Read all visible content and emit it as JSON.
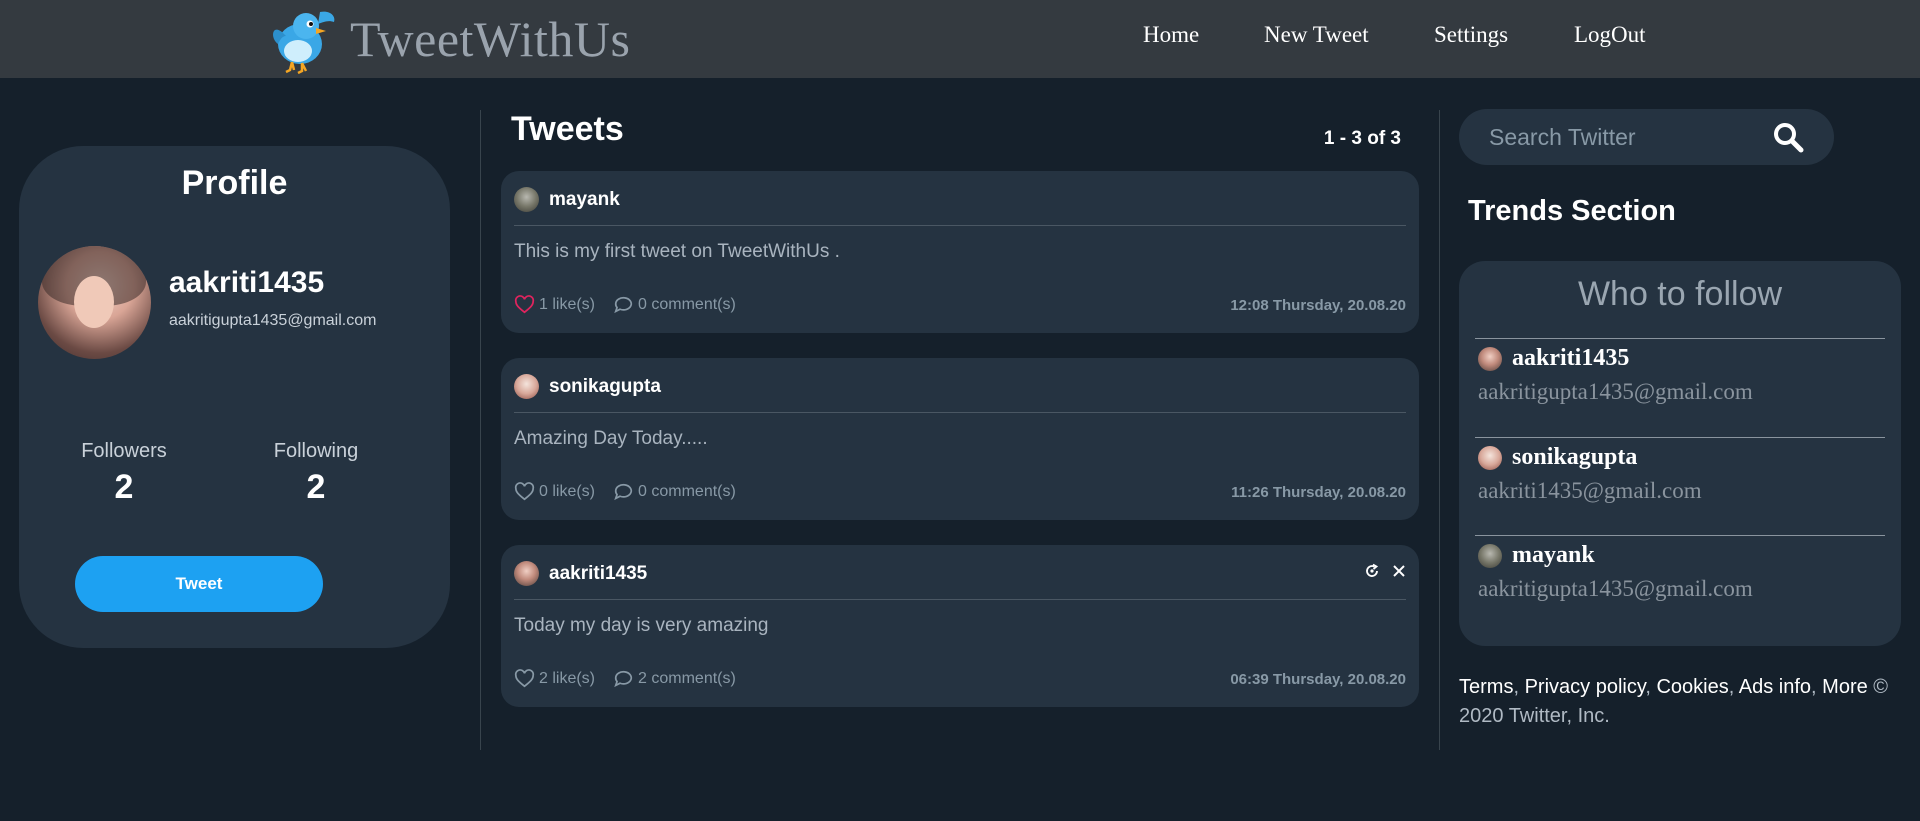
{
  "nav": {
    "brand": "TweetWithUs",
    "links": [
      "Home",
      "New Tweet",
      "Settings",
      "LogOut"
    ]
  },
  "profile": {
    "title": "Profile",
    "username": "aakriti1435",
    "email": "aakritigupta1435@gmail.com",
    "followers_label": "Followers",
    "followers_count": "2",
    "following_label": "Following",
    "following_count": "2",
    "tweet_button": "Tweet"
  },
  "feed": {
    "title": "Tweets",
    "pagination": "1 - 3 of 3",
    "tweets": [
      {
        "user": "mayank",
        "text": "This is my first tweet on TweetWithUs .",
        "likes": "1 like(s)",
        "comments": "0 comment(s)",
        "time": "12:08 Thursday, 20.08.20",
        "liked": true
      },
      {
        "user": "sonikagupta",
        "text": "Amazing Day Today.....",
        "likes": "0 like(s)",
        "comments": "0 comment(s)",
        "time": "11:26 Thursday, 20.08.20",
        "liked": false
      },
      {
        "user": "aakriti1435",
        "text": "Today my day is very amazing",
        "likes": "2 like(s)",
        "comments": "2 comment(s)",
        "time": "06:39 Thursday, 20.08.20",
        "liked": false
      }
    ]
  },
  "search": {
    "placeholder": "Search Twitter"
  },
  "trends": {
    "title": "Trends Section",
    "who_to_follow": "Who to follow",
    "people": [
      {
        "name": "aakriti1435",
        "email": "aakritigupta1435@gmail.com"
      },
      {
        "name": "sonikagupta",
        "email": "aakriti1435@gmail.com"
      },
      {
        "name": "mayank",
        "email": "aakritigupta1435@gmail.com"
      }
    ]
  },
  "footer": {
    "links": [
      "Terms",
      "Privacy policy",
      "Cookies",
      "Ads info",
      "More"
    ],
    "separator": ", ",
    "copyright": " © 2020 Twitter, Inc."
  },
  "colors": {
    "background": "#15202b",
    "card": "#253341",
    "navbar": "#343a40",
    "accent": "#1da1f2",
    "like_active": "#e0245e"
  },
  "icons": {
    "brand": "twitter-bird-icon",
    "search": "search-icon",
    "like": "heart-icon",
    "comment": "comment-bubble-icon",
    "edit": "refresh-edit-icon",
    "delete": "close-icon"
  }
}
